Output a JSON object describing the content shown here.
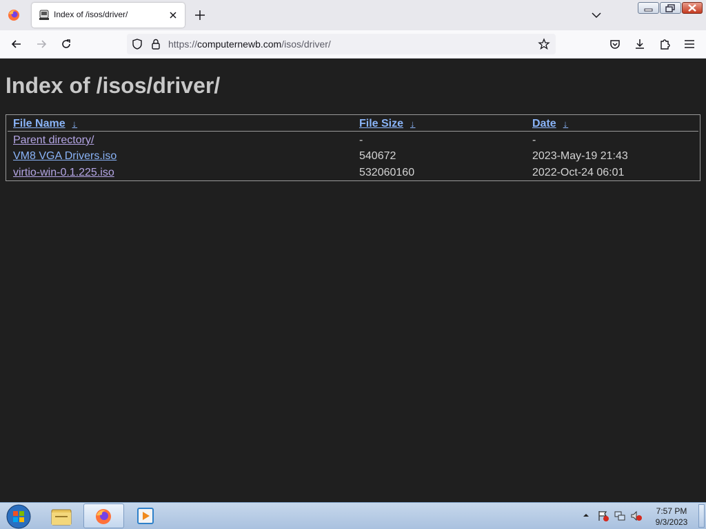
{
  "browser": {
    "tab_title": "Index of /isos/driver/",
    "url_scheme": "https://",
    "url_host": "computernewb.com",
    "url_path": "/isos/driver/"
  },
  "page": {
    "heading": "Index of /isos/driver/",
    "columns": [
      {
        "label": "File Name",
        "sort_arrow": "↓"
      },
      {
        "label": "File Size",
        "sort_arrow": "↓"
      },
      {
        "label": "Date",
        "sort_arrow": "↓"
      }
    ],
    "rows": [
      {
        "name": "Parent directory/",
        "size": "-",
        "date": "-"
      },
      {
        "name": "VM8 VGA Drivers.iso",
        "size": "540672",
        "date": "2023-May-19 21:43"
      },
      {
        "name": "virtio-win-0.1.225.iso",
        "size": "532060160",
        "date": "2022-Oct-24 06:01"
      }
    ]
  },
  "taskbar": {
    "time": "7:57 PM",
    "date": "9/3/2023"
  },
  "colors": {
    "page_bg": "#1f1f1f",
    "link": "#8ab4f8",
    "visited_link": "#b5a6e6",
    "text": "#d4d4d4"
  }
}
